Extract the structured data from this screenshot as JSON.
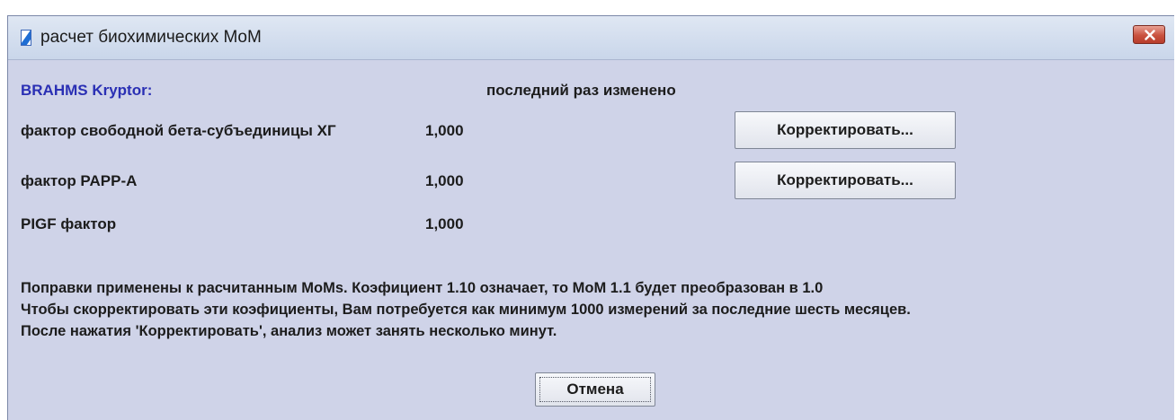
{
  "window": {
    "title": "расчет биохимических MoM",
    "close_glyph": "✕"
  },
  "header": {
    "brand": "BRAHMS Kryptor:",
    "last_changed": "последний раз изменено"
  },
  "factors": [
    {
      "label": "фактор свободной бета-субъединицы ХГ",
      "value": "1,000",
      "button": "Корректировать..."
    },
    {
      "label": "фактор PAPP-A",
      "value": "1,000",
      "button": "Корректировать..."
    },
    {
      "label": "PIGF фактор",
      "value": "1,000"
    }
  ],
  "notes": [
    "Поправки применены к расчитанным MoMs. Коэфициент 1.10 означает, то MoM 1.1 будет преобразован в 1.0",
    "Чтобы скорректировать эти коэфициенты, Вам потребуется как минимум 1000 измерений за последние шесть месяцев.",
    "После нажатия 'Корректировать', анализ может занять несколько минут."
  ],
  "buttons": {
    "cancel": "Отмена"
  },
  "colors": {
    "dialog_bg": "#cfd3e8",
    "brand_text": "#2a2fb4",
    "close_button": "#c9523f"
  },
  "icons": {
    "window": "app-document-icon",
    "close": "close-icon"
  }
}
